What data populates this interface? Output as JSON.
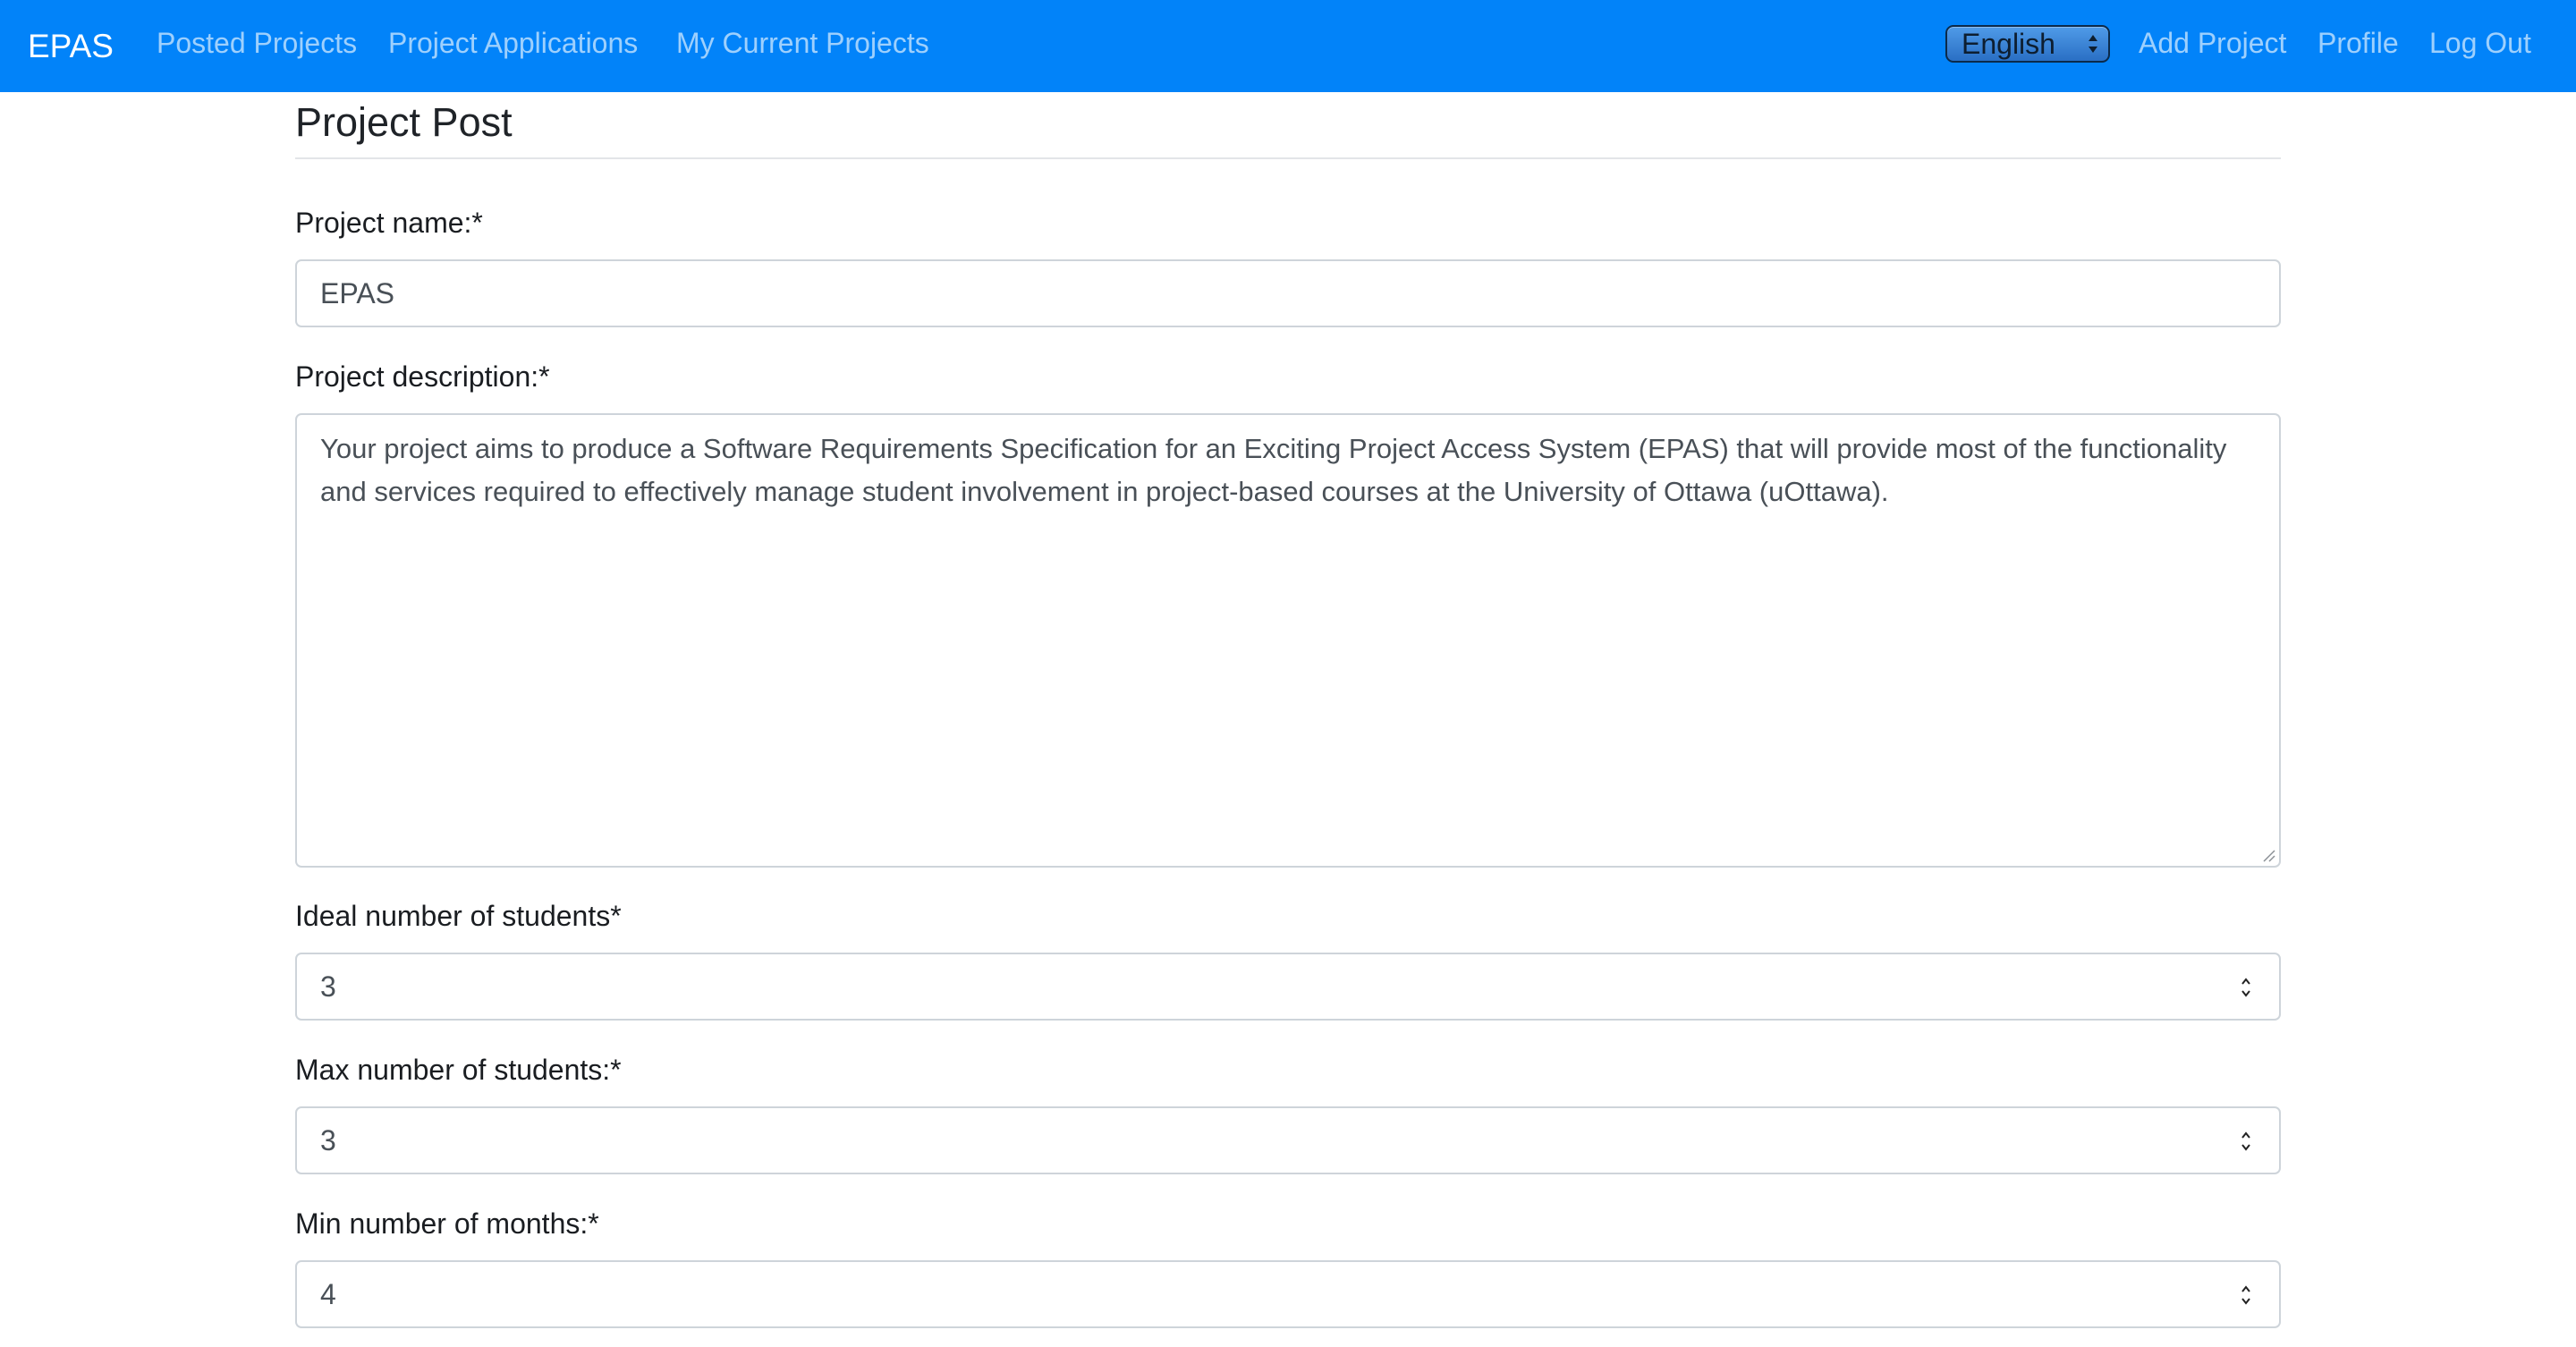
{
  "navbar": {
    "brand": "EPAS",
    "left_links": [
      {
        "label": "Posted Projects"
      },
      {
        "label": "Project Applications"
      },
      {
        "label": "My Current Projects"
      }
    ],
    "language": {
      "selected": "English"
    },
    "right_links": [
      {
        "label": "Add Project"
      },
      {
        "label": "Profile"
      },
      {
        "label": "Log Out"
      }
    ]
  },
  "form": {
    "title": "Project Post",
    "project_name": {
      "label": "Project name:*",
      "value": "EPAS"
    },
    "project_description": {
      "label": "Project description:*",
      "value": "Your project aims to produce a Software Requirements Specification for an Exciting Project Access System (EPAS) that will provide most of the functionality and services required to effectively manage student involvement in project-based courses at the University of Ottawa (uOttawa)."
    },
    "ideal_students": {
      "label": "Ideal number of students*",
      "value": "3"
    },
    "max_students": {
      "label": "Max number of students:*",
      "value": "3"
    },
    "min_months": {
      "label": "Min number of months:*",
      "value": "4"
    }
  },
  "colors": {
    "navbar_bg": "#0283f9",
    "input_border": "#ced4da",
    "text": "#212529"
  },
  "icons": {
    "language_select": "updown-chevron-icon",
    "number_spinner": "spinner-arrows-icon",
    "textarea_resize": "resize-grip-icon"
  }
}
